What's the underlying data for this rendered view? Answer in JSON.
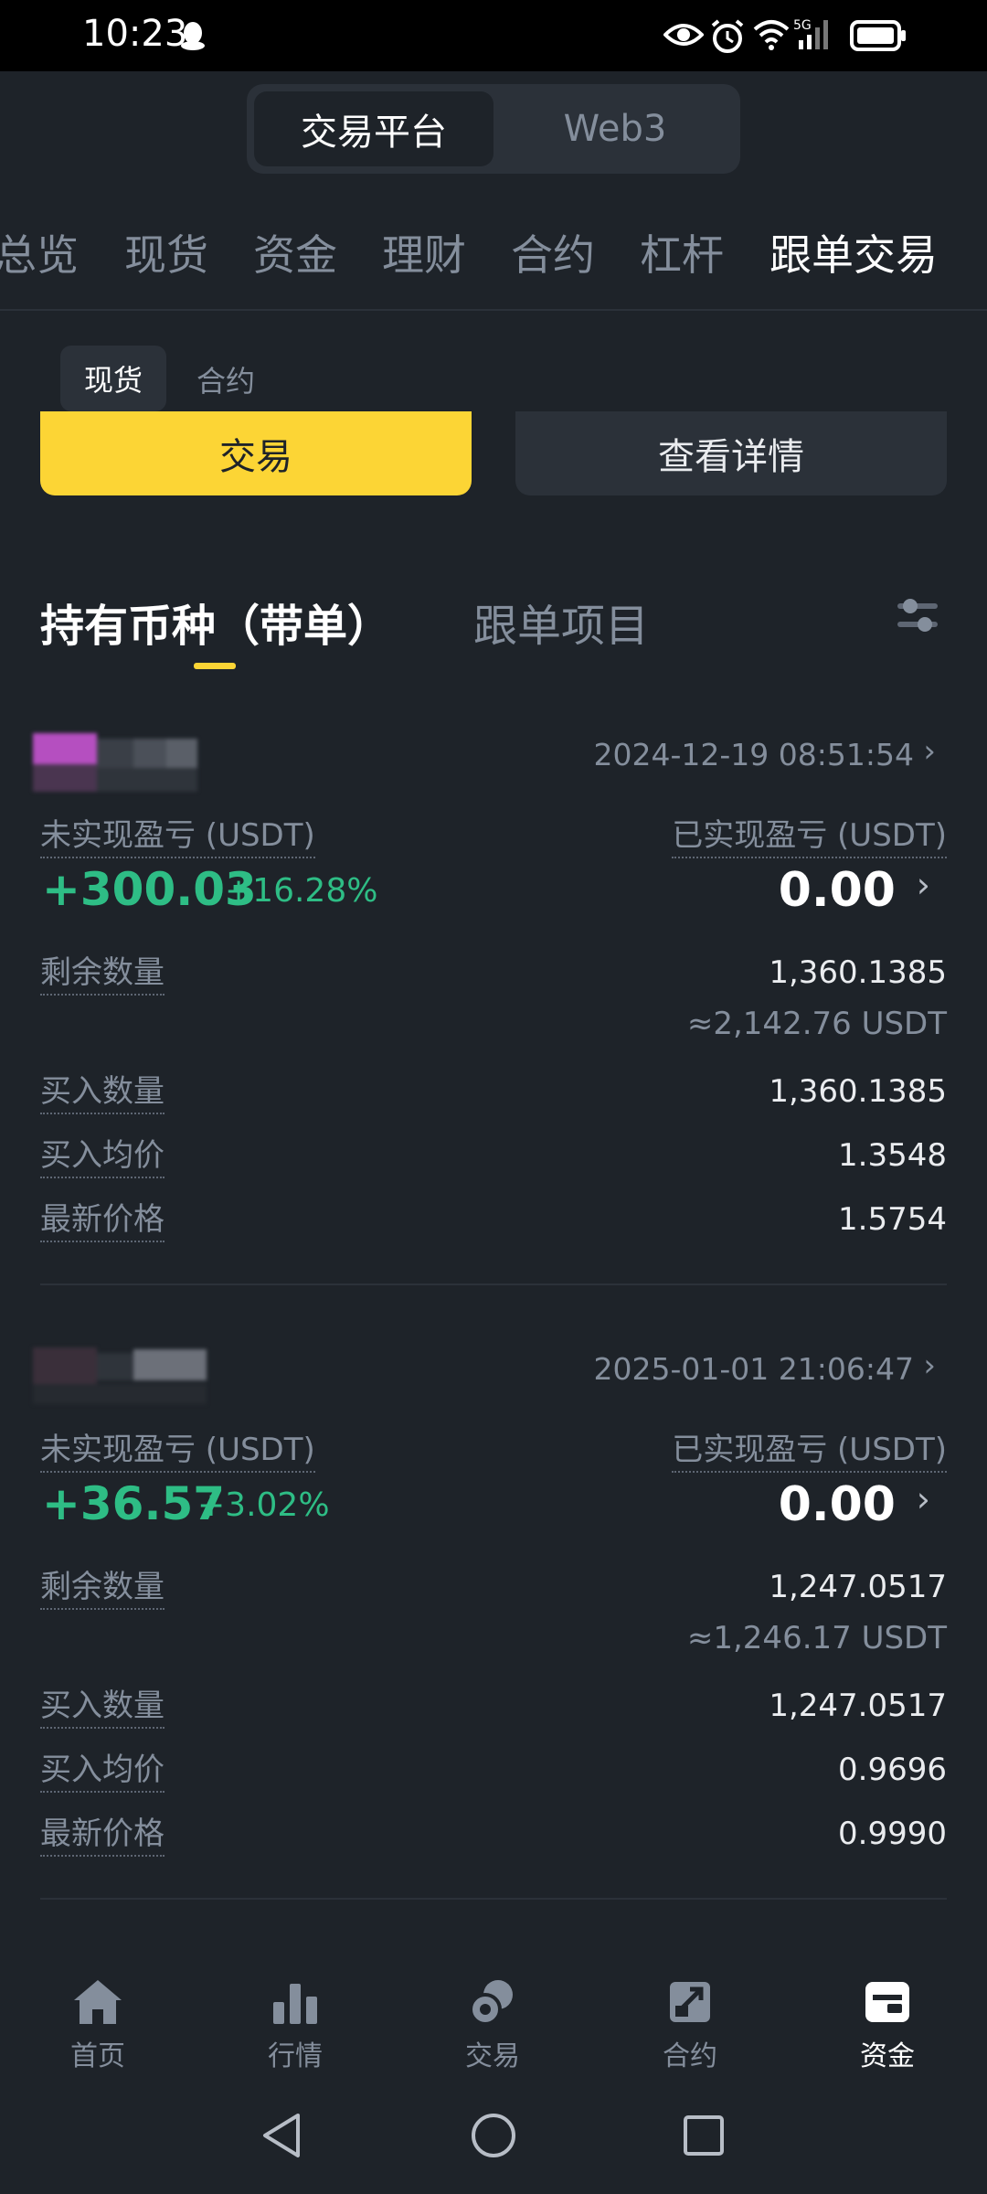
{
  "status_bar": {
    "time": "10:23",
    "network": "5G"
  },
  "platform_switch": {
    "options": [
      "交易平台",
      "Web3"
    ],
    "selected": "交易平台"
  },
  "top_tabs": [
    "总览",
    "现货",
    "资金",
    "理财",
    "合约",
    "杠杆",
    "跟单交易"
  ],
  "top_tabs_active": "跟单交易",
  "sub_tabs": [
    "现货",
    "合约"
  ],
  "sub_tabs_active": "现货",
  "actions": {
    "trade": "交易",
    "details": "查看详情"
  },
  "section_tabs": {
    "holdings": "持有币种（带单）",
    "projects": "跟单项目"
  },
  "positions": [
    {
      "datetime": "2024-12-19 08:51:54",
      "unrealized_label": "未实现盈亏 (USDT)",
      "unrealized_pnl": "+300.03",
      "unrealized_pct": "+16.28%",
      "realized_label": "已实现盈亏 (USDT)",
      "realized_pnl": "0.00",
      "remaining_label": "剩余数量",
      "remaining_qty": "1,360.1385",
      "remaining_usdt": "≈2,142.76 USDT",
      "buy_qty_label": "买入数量",
      "buy_qty": "1,360.1385",
      "avg_price_label": "买入均价",
      "avg_price": "1.3548",
      "last_price_label": "最新价格",
      "last_price": "1.5754"
    },
    {
      "datetime": "2025-01-01 21:06:47",
      "unrealized_label": "未实现盈亏 (USDT)",
      "unrealized_pnl": "+36.57",
      "unrealized_pct": "+3.02%",
      "realized_label": "已实现盈亏 (USDT)",
      "realized_pnl": "0.00",
      "remaining_label": "剩余数量",
      "remaining_qty": "1,247.0517",
      "remaining_usdt": "≈1,246.17 USDT",
      "buy_qty_label": "买入数量",
      "buy_qty": "1,247.0517",
      "avg_price_label": "买入均价",
      "avg_price": "0.9696",
      "last_price_label": "最新价格",
      "last_price": "0.9990"
    }
  ],
  "bottom_nav": [
    {
      "label": "首页",
      "icon": "home-icon"
    },
    {
      "label": "行情",
      "icon": "markets-icon"
    },
    {
      "label": "交易",
      "icon": "trade-icon"
    },
    {
      "label": "合约",
      "icon": "futures-icon"
    },
    {
      "label": "资金",
      "icon": "wallet-icon"
    }
  ],
  "bottom_nav_active": "资金",
  "colors": {
    "accent": "#fcd535",
    "positive": "#2ebd85",
    "background": "#1e2329",
    "muted": "#848e9c"
  }
}
